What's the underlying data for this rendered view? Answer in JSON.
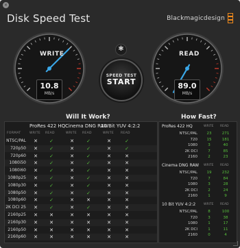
{
  "window": {
    "title": "Disk Speed Test",
    "brand": "Blackmagicdesign",
    "close_glyph": "×"
  },
  "gauges": {
    "write": {
      "label": "WRITE",
      "value": "10.8",
      "unit": "MB/s"
    },
    "read": {
      "label": "READ",
      "value": "89.0",
      "unit": "MB/s"
    }
  },
  "settings_glyph": "✱",
  "start_button": {
    "line1": "SPEED TEST",
    "line2": "START"
  },
  "will_it_work": {
    "title": "Will It Work?",
    "format_label": "FORMAT",
    "groups": [
      "ProRes 422 HQ",
      "Cinema DNG RAW",
      "10 Bit YUV 4:2:2"
    ],
    "sub_labels": [
      "WRITE",
      "READ",
      "WRITE",
      "READ",
      "WRITE",
      "READ"
    ],
    "rows": [
      {
        "format": "NTSC/PAL",
        "cells": [
          "x",
          "ok",
          "x",
          "ok",
          "x",
          "ok"
        ]
      },
      {
        "format": "720p50",
        "cells": [
          "x",
          "ok",
          "x",
          "ok",
          "x",
          "ok"
        ]
      },
      {
        "format": "720p60",
        "cells": [
          "x",
          "ok",
          "x",
          "ok",
          "x",
          "x"
        ]
      },
      {
        "format": "1080i50",
        "cells": [
          "x",
          "ok",
          "x",
          "ok",
          "x",
          "x"
        ]
      },
      {
        "format": "1080i60",
        "cells": [
          "x",
          "ok",
          "x",
          "ok",
          "x",
          "x"
        ]
      },
      {
        "format": "1080p25",
        "cells": [
          "x",
          "ok",
          "x",
          "ok",
          "x",
          "x"
        ]
      },
      {
        "format": "1080p30",
        "cells": [
          "x",
          "ok",
          "x",
          "ok",
          "x",
          "x"
        ]
      },
      {
        "format": "1080p50",
        "cells": [
          "x",
          "ok",
          "x",
          "ok",
          "x",
          "x"
        ]
      },
      {
        "format": "1080p60",
        "cells": [
          "x",
          "ok",
          "x",
          "x",
          "x",
          "x"
        ]
      },
      {
        "format": "2K DCI 25",
        "cells": [
          "x",
          "ok",
          "x",
          "ok",
          "x",
          "x"
        ]
      },
      {
        "format": "2160p25",
        "cells": [
          "x",
          "x",
          "x",
          "x",
          "x",
          "x"
        ]
      },
      {
        "format": "2160p30",
        "cells": [
          "x",
          "x",
          "x",
          "x",
          "x",
          "x"
        ]
      },
      {
        "format": "2160p50",
        "cells": [
          "x",
          "x",
          "x",
          "x",
          "x",
          "x"
        ]
      },
      {
        "format": "2160p60",
        "cells": [
          "x",
          "x",
          "x",
          "x",
          "x",
          "x"
        ]
      }
    ],
    "glyphs": {
      "x": "✕",
      "ok": "✓"
    }
  },
  "how_fast": {
    "title": "How Fast?",
    "col_write": "WRITE",
    "col_read": "READ",
    "sections": [
      {
        "name": "ProRes 422 HQ",
        "rows": [
          {
            "label": "NTSC/PAL",
            "write": "23",
            "read": "271"
          },
          {
            "label": "720",
            "write": "15",
            "read": "181"
          },
          {
            "label": "1080",
            "write": "3",
            "read": "40"
          },
          {
            "label": "2K DCI",
            "write": "7",
            "read": "85"
          },
          {
            "label": "2160",
            "write": "2",
            "read": "23"
          }
        ]
      },
      {
        "name": "Cinema DNG RAW",
        "rows": [
          {
            "label": "NTSC/PAL",
            "write": "19",
            "read": "232"
          },
          {
            "label": "720",
            "write": "7",
            "read": "84"
          },
          {
            "label": "1080",
            "write": "3",
            "read": "28"
          },
          {
            "label": "2K DCI",
            "write": "2",
            "read": "24"
          },
          {
            "label": "2160",
            "write": "1",
            "read": "9"
          }
        ]
      },
      {
        "name": "10 Bit YUV 4:2:2",
        "rows": [
          {
            "label": "NTSC/PAL",
            "write": "8",
            "read": "100"
          },
          {
            "label": "720",
            "write": "3",
            "read": "38"
          },
          {
            "label": "1080",
            "write": "1",
            "read": "17"
          },
          {
            "label": "2K DCI",
            "write": "1",
            "read": "11"
          },
          {
            "label": "2160",
            "write": "0",
            "read": "4"
          }
        ]
      }
    ]
  },
  "colors": {
    "accent_needle": "#3aa6e6",
    "ok_green": "#58c23c",
    "redline": "#c0392b",
    "brand_orange": "#f08a1c"
  }
}
